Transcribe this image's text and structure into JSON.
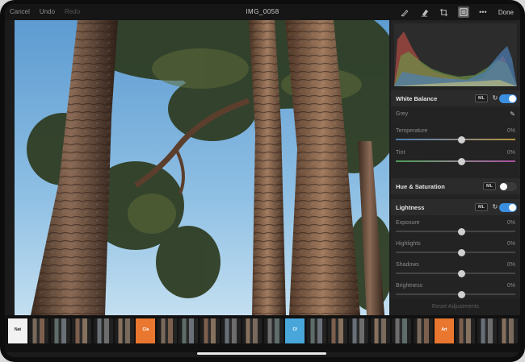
{
  "topbar": {
    "cancel": "Cancel",
    "undo": "Undo",
    "redo": "Redo",
    "title": "IMG_0058",
    "done": "Done",
    "icons": [
      "brush-icon",
      "eraser-icon",
      "crop-icon",
      "adjustments-icon",
      "more-icon"
    ]
  },
  "panel": {
    "white_balance": {
      "title": "White Balance",
      "ml": "ML",
      "enabled": true,
      "grey_label": "Grey",
      "temperature_label": "Temperature",
      "temperature_value": "0%",
      "temperature_level": 0.55,
      "tint_label": "Tint",
      "tint_value": "0%",
      "tint_level": 0.55
    },
    "hue_saturation": {
      "title": "Hue & Saturation",
      "ml": "ML",
      "enabled": false
    },
    "lightness": {
      "title": "Lightness",
      "ml": "ML",
      "enabled": true,
      "rows": [
        {
          "label": "Exposure",
          "value": "0%",
          "level": 0.55
        },
        {
          "label": "Highlights",
          "value": "0%",
          "level": 0.55
        },
        {
          "label": "Shadows",
          "value": "0%",
          "level": 0.55
        },
        {
          "label": "Brightness",
          "value": "0%",
          "level": 0.55
        }
      ]
    },
    "reset_label": "Reset Adjustments"
  },
  "filmstrip": [
    {
      "tag": "Nat",
      "kind": "white"
    },
    {
      "kind": "photo"
    },
    {
      "kind": "photo"
    },
    {
      "kind": "photo"
    },
    {
      "kind": "photo"
    },
    {
      "kind": "photo"
    },
    {
      "tag": "Cla",
      "kind": "orange"
    },
    {
      "kind": "photo"
    },
    {
      "kind": "photo"
    },
    {
      "kind": "photo"
    },
    {
      "kind": "photo"
    },
    {
      "kind": "photo"
    },
    {
      "kind": "photo"
    },
    {
      "tag": "Cf",
      "kind": "blue"
    },
    {
      "kind": "photo"
    },
    {
      "kind": "photo"
    },
    {
      "kind": "photo"
    },
    {
      "kind": "photo"
    },
    {
      "kind": "photo"
    },
    {
      "kind": "photo"
    },
    {
      "tag": "Art",
      "kind": "orange"
    },
    {
      "kind": "photo"
    },
    {
      "kind": "photo"
    },
    {
      "kind": "photo"
    }
  ],
  "colors": {
    "accent": "#3b8fe0",
    "orange": "#e9772f",
    "blue": "#49a6da"
  }
}
